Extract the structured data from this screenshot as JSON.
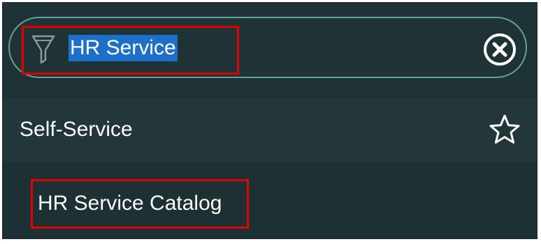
{
  "search": {
    "query": "HR Service",
    "filter_icon": "filter-icon",
    "clear_icon": "close-circle-icon"
  },
  "section": {
    "label": "Self-Service",
    "favorite_icon": "star-icon"
  },
  "results": [
    {
      "label": "HR Service Catalog"
    }
  ],
  "colors": {
    "background": "#23373a",
    "search_border": "#5fa596",
    "selection": "#1e6fc8",
    "highlight_annotation": "#e50000",
    "text": "#ffffff"
  }
}
